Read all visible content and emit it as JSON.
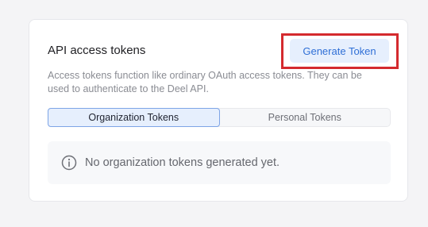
{
  "section": {
    "title": "API access tokens",
    "generate_button_label": "Generate  Token",
    "description": "Access tokens function like ordinary OAuth access tokens. They can be used to authenticate to the Deel API."
  },
  "tabs": [
    {
      "label": "Organization Tokens",
      "active": true
    },
    {
      "label": "Personal Tokens",
      "active": false
    }
  ],
  "empty_state": {
    "icon": "info-icon",
    "message": "No organization tokens generated yet."
  },
  "colors": {
    "accent": "#2f6fd6",
    "accent_bg": "#e6effd",
    "highlight_outline": "#d42a2e"
  }
}
